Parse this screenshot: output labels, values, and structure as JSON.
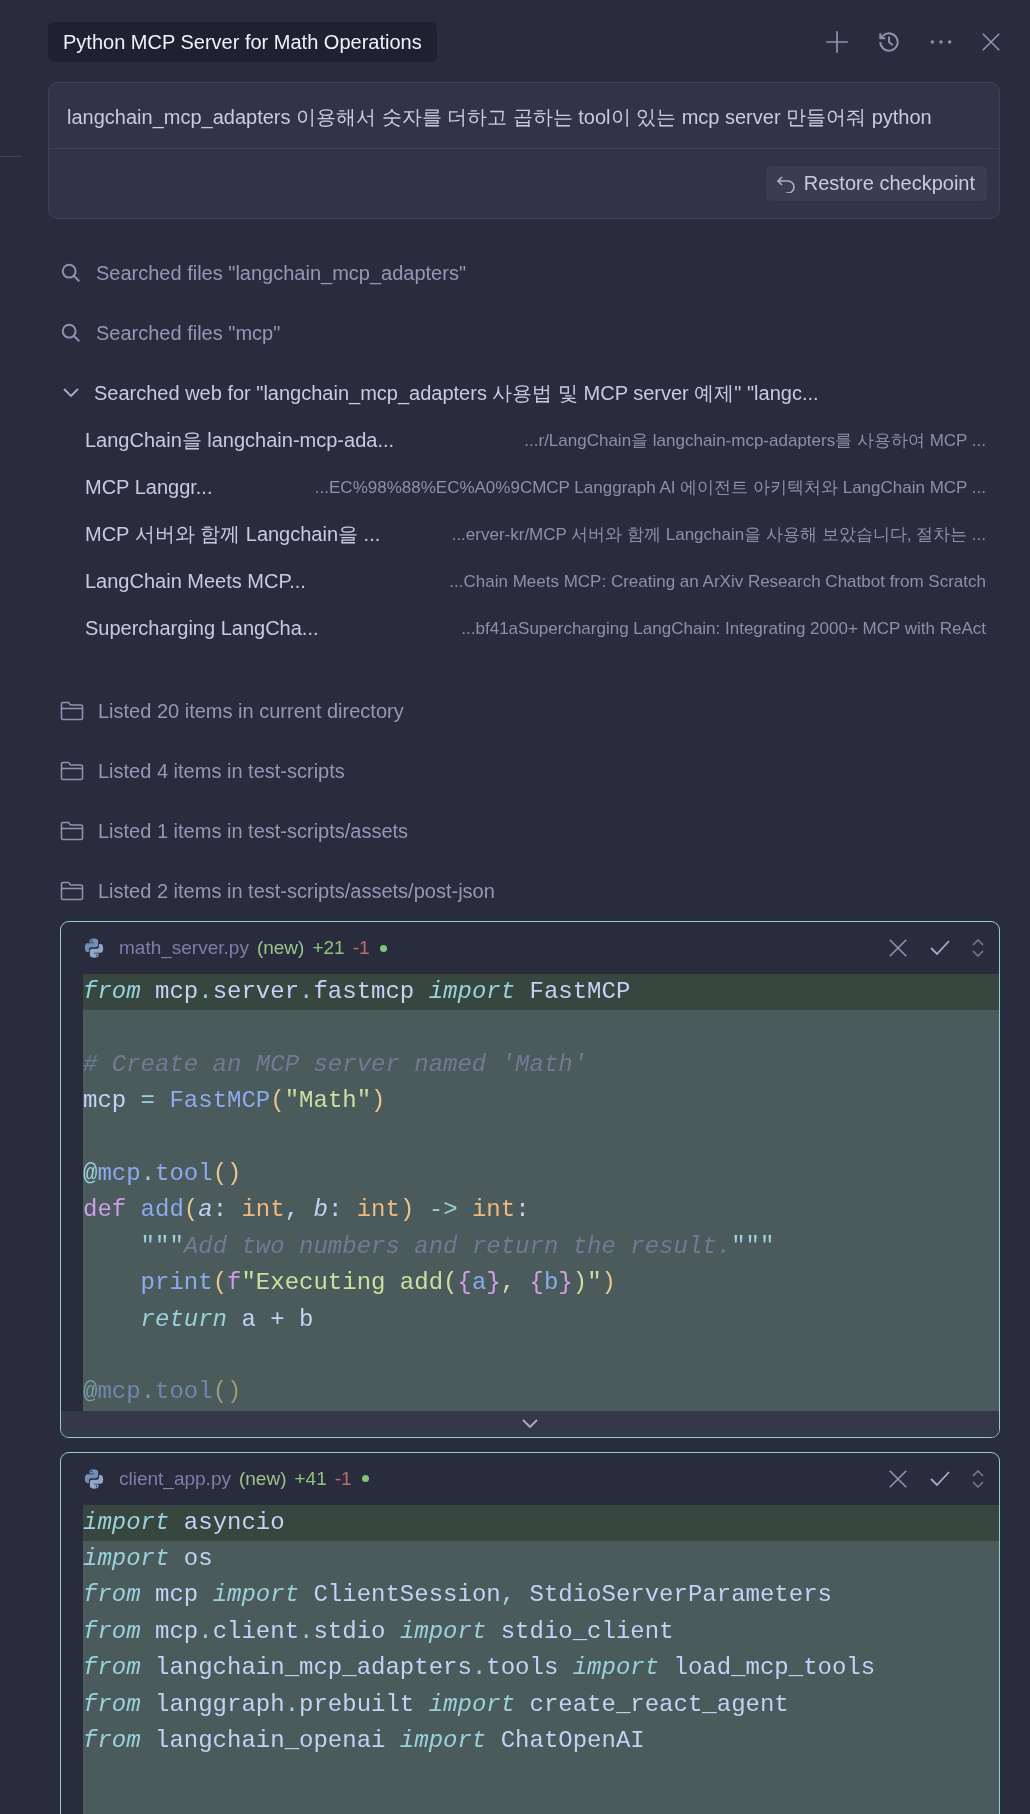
{
  "header": {
    "title": "Python MCP Server for Math Operations"
  },
  "prompt": {
    "text": "langchain_mcp_adapters 이용해서 숫자를 더하고 곱하는 tool이 있는 mcp server 만들어줘 python",
    "restore_label": "Restore checkpoint"
  },
  "activity": [
    {
      "kind": "search",
      "label": "Searched files \"langchain_mcp_adapters\""
    },
    {
      "kind": "search",
      "label": "Searched files \"mcp\""
    },
    {
      "kind": "web",
      "label": "Searched web for \"langchain_mcp_adapters 사용법 및 MCP server 예제\" \"langc...",
      "expanded": true,
      "results": [
        {
          "title": "LangChain을 langchain-mcp-ada...",
          "url": "...r/LangChain을 langchain-mcp-adapters를 사용하여 MCP ..."
        },
        {
          "title": "MCP Langgr...",
          "url": "...EC%98%88%EC%A0%9CMCP Langgraph AI 에이전트 아키텍처와 LangChain MCP ..."
        },
        {
          "title": "MCP 서버와 함께 Langchain을 ...",
          "url": "...erver-kr/MCP 서버와 함께 Langchain을 사용해 보았습니다, 절차는 ..."
        },
        {
          "title": "LangChain Meets MCP...",
          "url": "...Chain Meets MCP: Creating an ArXiv Research Chatbot from Scratch"
        },
        {
          "title": "Supercharging LangCha...",
          "url": "...bf41aSupercharging LangChain: Integrating 2000+ MCP with ReAct"
        }
      ]
    },
    {
      "kind": "folder",
      "label": "Listed 20 items in current directory"
    },
    {
      "kind": "folder",
      "label": "Listed 4 items in test-scripts"
    },
    {
      "kind": "folder",
      "label": "Listed 1 items in test-scripts/assets"
    },
    {
      "kind": "folder",
      "label": "Listed 2 items in test-scripts/assets/post-json"
    }
  ],
  "files": [
    {
      "name": "math_server.py",
      "tag": "(new)",
      "added": "+21",
      "removed": "-1",
      "collapsed": true,
      "lines": [
        {
          "highlighted": true,
          "tokens": [
            {
              "text": "from",
              "kind": "keyword"
            },
            {
              "text": " mcp",
              "kind": "plain"
            },
            {
              "text": ".",
              "kind": "op"
            },
            {
              "text": "server",
              "kind": "plain"
            },
            {
              "text": ".",
              "kind": "op"
            },
            {
              "text": "fastmcp ",
              "kind": "plain"
            },
            {
              "text": "import",
              "kind": "keyword"
            },
            {
              "text": " FastMCP",
              "kind": "plain"
            }
          ]
        },
        {
          "highlighted": false
        },
        {
          "highlighted": false,
          "tokens": [
            {
              "text": "# Create an MCP server named 'Math'",
              "kind": "comment"
            }
          ]
        },
        {
          "highlighted": false,
          "tokens": [
            {
              "text": "mcp",
              "kind": "plain"
            },
            {
              "text": " = ",
              "kind": "op"
            },
            {
              "text": "FastMCP",
              "kind": "func"
            },
            {
              "text": "(",
              "kind": "paren"
            },
            {
              "text": "\"Math\"",
              "kind": "string"
            },
            {
              "text": ")",
              "kind": "paren"
            }
          ]
        },
        {
          "highlighted": false
        },
        {
          "highlighted": false,
          "tokens": [
            {
              "text": "@",
              "kind": "op"
            },
            {
              "text": "mcp",
              "kind": "func"
            },
            {
              "text": ".",
              "kind": "op"
            },
            {
              "text": "tool",
              "kind": "func"
            },
            {
              "text": "()",
              "kind": "paren"
            }
          ]
        },
        {
          "highlighted": false,
          "tokens": [
            {
              "text": "def ",
              "kind": "def"
            },
            {
              "text": "add",
              "kind": "func"
            },
            {
              "text": "(",
              "kind": "paren"
            },
            {
              "text": "a",
              "kind": "param"
            },
            {
              "text": ": ",
              "kind": "plain"
            },
            {
              "text": "int",
              "kind": "type"
            },
            {
              "text": ", ",
              "kind": "plain"
            },
            {
              "text": "b",
              "kind": "param"
            },
            {
              "text": ": ",
              "kind": "plain"
            },
            {
              "text": "int",
              "kind": "type"
            },
            {
              "text": ")",
              "kind": "paren"
            },
            {
              "text": " -> ",
              "kind": "op"
            },
            {
              "text": "int",
              "kind": "type"
            },
            {
              "text": ":",
              "kind": "plain"
            }
          ]
        },
        {
          "highlighted": false,
          "tokens": [
            {
              "text": "    \"\"\"",
              "kind": "op"
            },
            {
              "text": "Add two numbers and return the result.",
              "kind": "comment"
            },
            {
              "text": "\"\"\"",
              "kind": "op"
            }
          ]
        },
        {
          "highlighted": false,
          "tokens": [
            {
              "text": "    print",
              "kind": "func"
            },
            {
              "text": "(",
              "kind": "paren"
            },
            {
              "text": "f",
              "kind": "def"
            },
            {
              "text": "\"Executing add(",
              "kind": "string"
            },
            {
              "text": "{",
              "kind": "brace"
            },
            {
              "text": "a",
              "kind": "func"
            },
            {
              "text": "}",
              "kind": "brace"
            },
            {
              "text": ", ",
              "kind": "string"
            },
            {
              "text": "{",
              "kind": "brace"
            },
            {
              "text": "b",
              "kind": "func"
            },
            {
              "text": "}",
              "kind": "brace"
            },
            {
              "text": ")\"",
              "kind": "string"
            },
            {
              "text": ")",
              "kind": "paren"
            }
          ]
        },
        {
          "highlighted": false,
          "tokens": [
            {
              "text": "    return",
              "kind": "keyword"
            },
            {
              "text": " a + b",
              "kind": "plain"
            }
          ]
        },
        {
          "highlighted": false
        },
        {
          "highlighted": false,
          "tokens": [
            {
              "text": "@",
              "kind": "op"
            },
            {
              "text": "mcp",
              "kind": "func"
            },
            {
              "text": ".",
              "kind": "op"
            },
            {
              "text": "tool",
              "kind": "func"
            },
            {
              "text": "()",
              "kind": "paren"
            }
          ]
        }
      ]
    },
    {
      "name": "client_app.py",
      "tag": "(new)",
      "added": "+41",
      "removed": "-1",
      "collapsed": false,
      "lines": [
        {
          "highlighted": true,
          "tokens": [
            {
              "text": "import",
              "kind": "keyword"
            },
            {
              "text": " asyncio",
              "kind": "plain"
            }
          ]
        },
        {
          "highlighted": false,
          "tokens": [
            {
              "text": "import",
              "kind": "keyword"
            },
            {
              "text": " os",
              "kind": "plain"
            }
          ]
        },
        {
          "highlighted": false,
          "tokens": [
            {
              "text": "from",
              "kind": "keyword"
            },
            {
              "text": " mcp ",
              "kind": "plain"
            },
            {
              "text": "import",
              "kind": "keyword"
            },
            {
              "text": " ClientSession",
              "kind": "plain"
            },
            {
              "text": ",",
              "kind": "op"
            },
            {
              "text": " StdioServerParameters",
              "kind": "plain"
            }
          ]
        },
        {
          "highlighted": false,
          "tokens": [
            {
              "text": "from",
              "kind": "keyword"
            },
            {
              "text": " mcp",
              "kind": "plain"
            },
            {
              "text": ".",
              "kind": "op"
            },
            {
              "text": "client",
              "kind": "plain"
            },
            {
              "text": ".",
              "kind": "op"
            },
            {
              "text": "stdio ",
              "kind": "plain"
            },
            {
              "text": "import",
              "kind": "keyword"
            },
            {
              "text": " stdio_client",
              "kind": "plain"
            }
          ]
        },
        {
          "highlighted": false,
          "tokens": [
            {
              "text": "from",
              "kind": "keyword"
            },
            {
              "text": " langchain_mcp_adapters",
              "kind": "plain"
            },
            {
              "text": ".",
              "kind": "op"
            },
            {
              "text": "tools ",
              "kind": "plain"
            },
            {
              "text": "import",
              "kind": "keyword"
            },
            {
              "text": " load_mcp_tools",
              "kind": "plain"
            }
          ]
        },
        {
          "highlighted": false,
          "tokens": [
            {
              "text": "from",
              "kind": "keyword"
            },
            {
              "text": " langgraph",
              "kind": "plain"
            },
            {
              "text": ".",
              "kind": "op"
            },
            {
              "text": "prebuilt ",
              "kind": "plain"
            },
            {
              "text": "import",
              "kind": "keyword"
            },
            {
              "text": " create_react_agent",
              "kind": "plain"
            }
          ]
        },
        {
          "highlighted": false,
          "tokens": [
            {
              "text": "from",
              "kind": "keyword"
            },
            {
              "text": " langchain_openai ",
              "kind": "plain"
            },
            {
              "text": "import",
              "kind": "keyword"
            },
            {
              "text": " ChatOpenAI",
              "kind": "plain"
            }
          ]
        },
        {
          "highlighted": false
        },
        {
          "highlighted": false
        }
      ]
    }
  ]
}
